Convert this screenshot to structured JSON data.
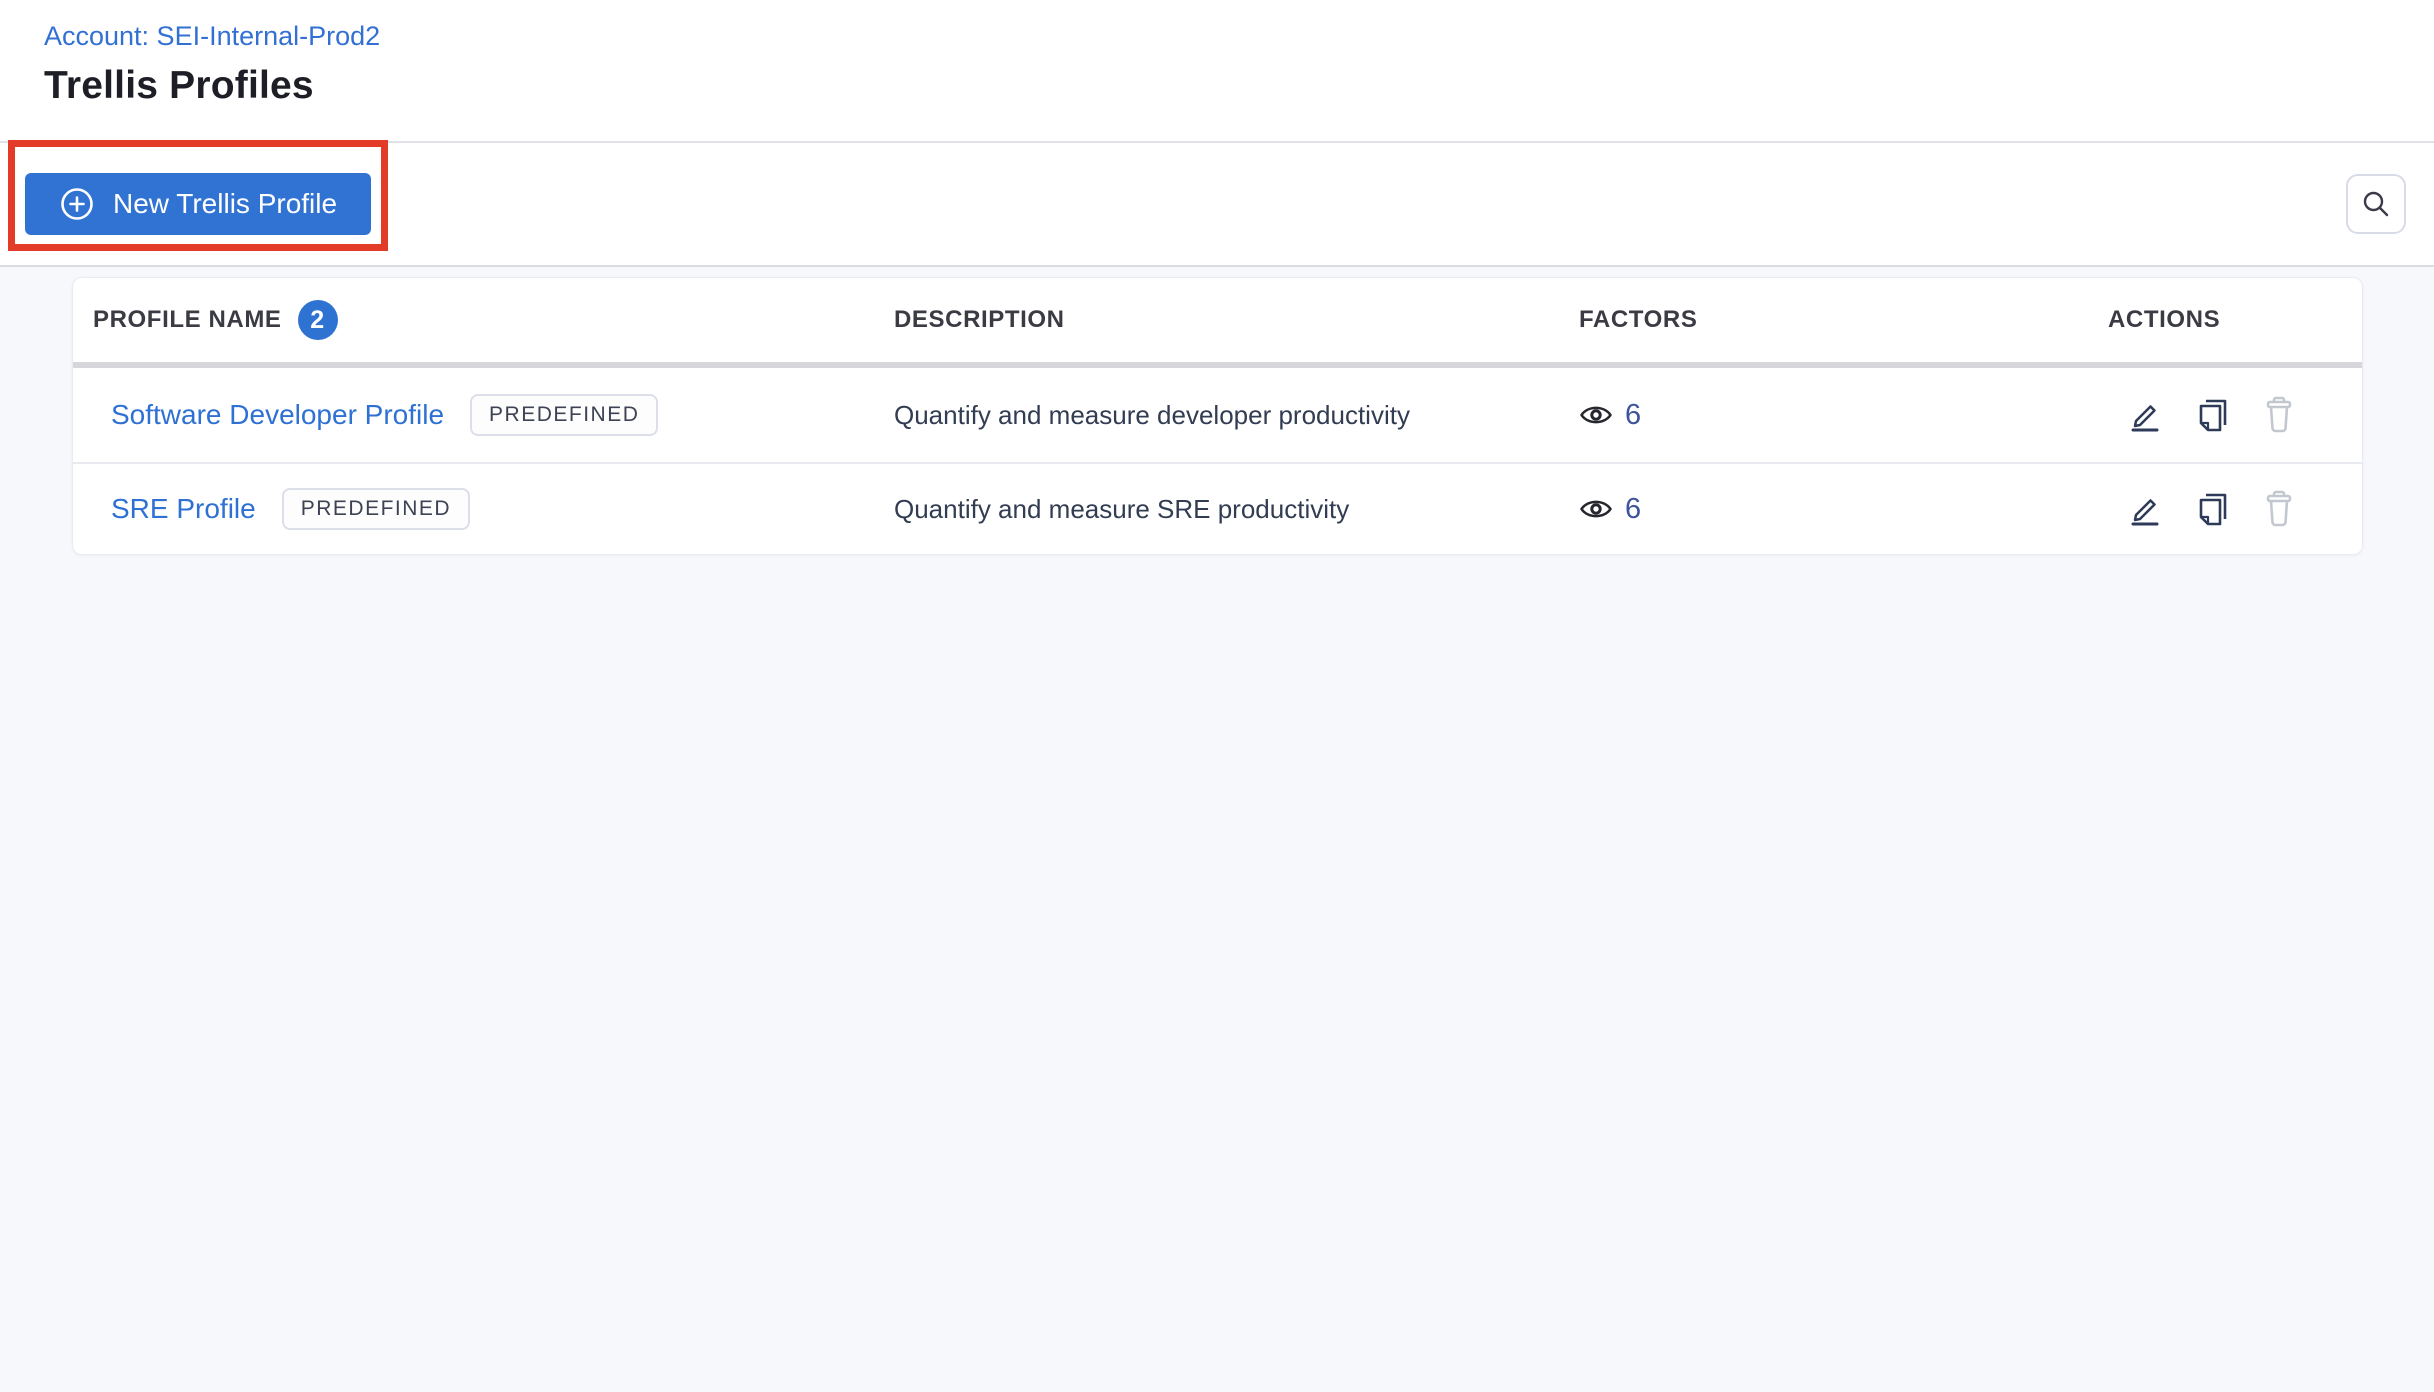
{
  "page": {
    "account_label": "Account: SEI-Internal-Prod2",
    "title": "Trellis Profiles"
  },
  "toolbar": {
    "new_profile_button_label": "New Trellis Profile"
  },
  "table": {
    "profile_count": "2",
    "columns": {
      "profile_name": "PROFILE NAME",
      "description": "DESCRIPTION",
      "factors": "FACTORS",
      "actions": "ACTIONS"
    },
    "rows": [
      {
        "name": "Software Developer Profile",
        "tag": "PREDEFINED",
        "description": "Quantify and measure developer productivity",
        "factors": "6"
      },
      {
        "name": "SRE Profile",
        "tag": "PREDEFINED",
        "description": "Quantify and measure SRE productivity",
        "factors": "6"
      }
    ]
  },
  "icons": {
    "new_profile": "plus-circle",
    "search": "magnifier",
    "factors": "eye",
    "edit": "pencil-underline",
    "clone": "copy-pages",
    "delete": "trash"
  },
  "colors": {
    "primary_blue": "#3173D2",
    "link_blue": "#3370D4",
    "badge_blue": "#2E72D2",
    "annotation_red": "#E23B27",
    "icon_navy": "#2E3A59",
    "disabled_icon_gray": "#C3C7D0",
    "body_background": "#F7F8FC"
  }
}
